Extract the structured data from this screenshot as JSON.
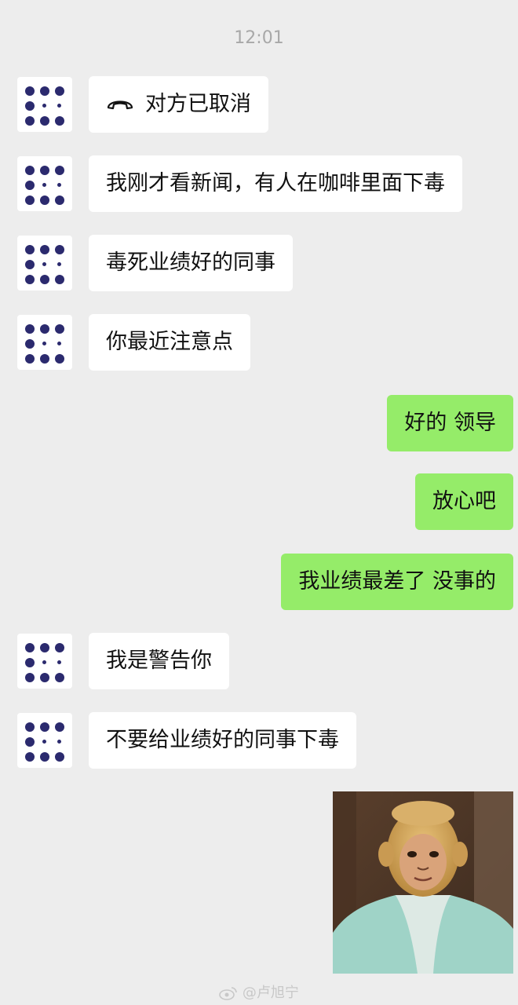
{
  "chat": {
    "timestamp": "12:01",
    "messages": [
      {
        "side": "left",
        "text": "对方已取消",
        "icon": "phone-hangup-icon"
      },
      {
        "side": "left",
        "text": "我刚才看新闻，有人在咖啡里面下毒"
      },
      {
        "side": "left",
        "text": "毒死业绩好的同事"
      },
      {
        "side": "left",
        "text": "你最近注意点"
      },
      {
        "side": "right",
        "text": "好的 领导"
      },
      {
        "side": "right",
        "text": "放心吧"
      },
      {
        "side": "right",
        "text": "我业绩最差了 没事的"
      },
      {
        "side": "left",
        "text": "我是警告你"
      },
      {
        "side": "left",
        "text": "不要给业绩好的同事下毒"
      },
      {
        "side": "right",
        "type": "image",
        "description": "monkey-king-meme-photo"
      }
    ]
  },
  "watermark": {
    "text": "@卢旭宁",
    "icon": "weibo-icon"
  },
  "colors": {
    "background": "#ededed",
    "incoming_bubble": "#ffffff",
    "outgoing_bubble": "#95ec69",
    "avatar_dots": "#2b2a6e"
  }
}
